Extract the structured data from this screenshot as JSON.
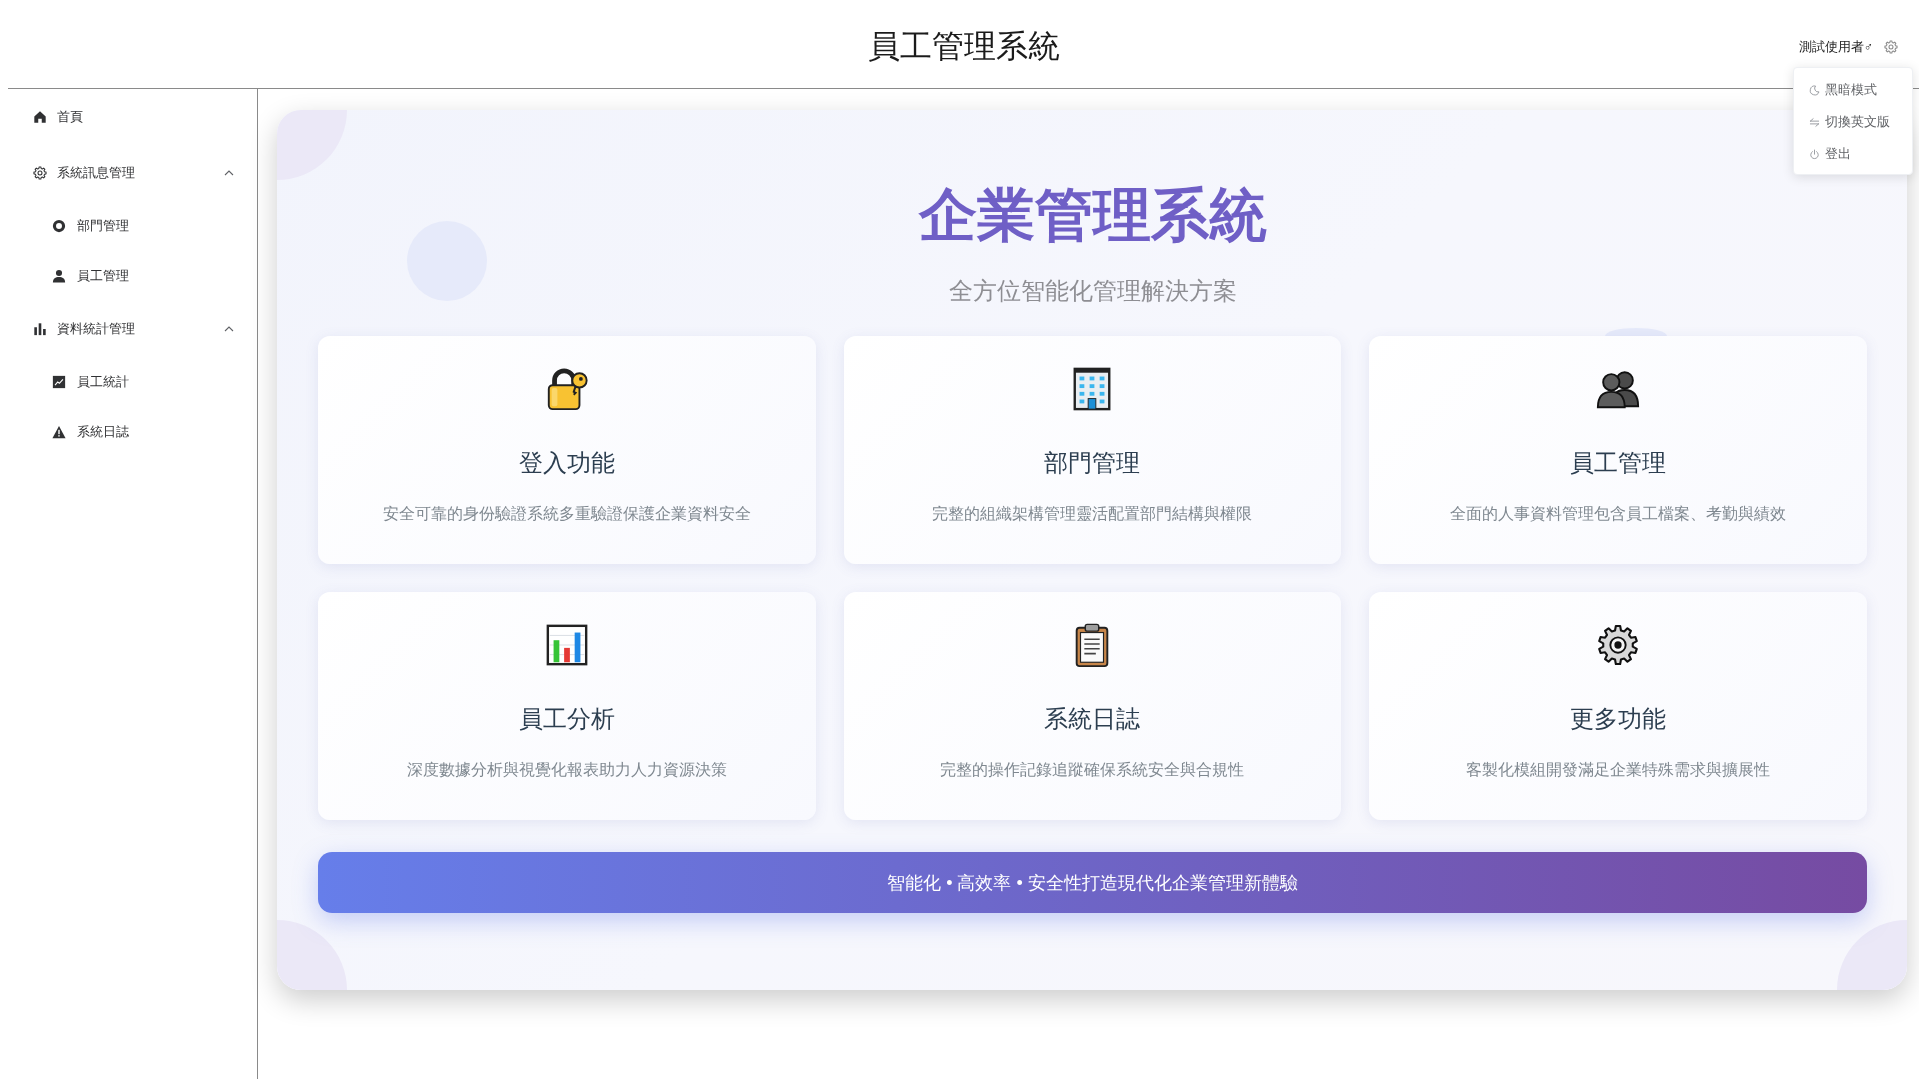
{
  "header": {
    "title": "員工管理系統",
    "user_name": "測試使用者♂"
  },
  "user_menu": [
    "黑暗模式",
    "切換英文版",
    "登出"
  ],
  "sidebar": {
    "items": [
      {
        "label": "首頁"
      },
      {
        "label": "系統訊息管理",
        "expanded": true,
        "children": [
          {
            "label": "部門管理"
          },
          {
            "label": "員工管理"
          }
        ]
      },
      {
        "label": "資料統計管理",
        "expanded": true,
        "children": [
          {
            "label": "員工統計"
          },
          {
            "label": "系統日誌"
          }
        ]
      }
    ]
  },
  "hero": {
    "title": "企業管理系統",
    "subtitle": "全方位智能化管理解決方案"
  },
  "features": [
    {
      "title": "登入功能",
      "description": "安全可靠的身份驗證系統多重驗證保護企業資料安全"
    },
    {
      "title": "部門管理",
      "description": "完整的組織架構管理靈活配置部門結構與權限"
    },
    {
      "title": "員工管理",
      "description": "全面的人事資料管理包含員工檔案、考勤與績效"
    },
    {
      "title": "員工分析",
      "description": "深度數據分析與視覺化報表助力人力資源決策"
    },
    {
      "title": "系統日誌",
      "description": "完整的操作記錄追蹤確保系統安全與合規性"
    },
    {
      "title": "更多功能",
      "description": "客製化模組開發滿足企業特殊需求與擴展性"
    }
  ],
  "banner": {
    "text": "智能化 • 高效率 • 安全性打造現代化企業管理新體驗"
  }
}
